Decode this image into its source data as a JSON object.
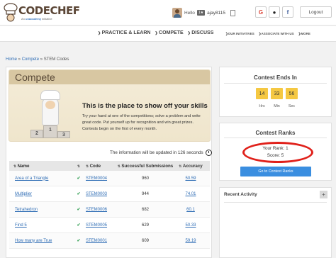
{
  "header": {
    "logo_text": "CODECHEF",
    "logo_sub_prefix": "An",
    "logo_sub_brand": "unacademy",
    "logo_sub_suffix": "initiative",
    "hello": "Hello",
    "rating_badge": "1★",
    "username": "ajay8115",
    "logout_label": "Logout",
    "social": [
      "G",
      "●",
      "f"
    ]
  },
  "nav": {
    "main": [
      "PRACTICE & LEARN",
      "COMPETE",
      "DISCUSS"
    ],
    "sub": [
      "OUR INITIATIVES",
      "ASSOCIATE WITH US",
      "MORE"
    ]
  },
  "breadcrumb": {
    "home": "Home",
    "sep1": " » ",
    "compete": "Compete",
    "sep2": " » ",
    "current": "STEM Codes"
  },
  "banner": {
    "title": "Compete",
    "heading": "This is the place to show off your skills",
    "text": "Try your hand at one of the competitions; solve a problem and write great code. Put yourself up for recognition and win great prizes. Contests begin on the first of every month.",
    "podium": [
      "2",
      "1",
      "3"
    ]
  },
  "info_text": "The information will be updated in 126 seconds",
  "table": {
    "headers": {
      "name": "Name",
      "code": "Code",
      "successful": "Successful Submissions",
      "accuracy": "Accuracy"
    },
    "rows": [
      {
        "name": "Area of a Triangle",
        "tick": "✔",
        "code": "STEM0004",
        "successful": "960",
        "accuracy": "50.59"
      },
      {
        "name": "Multiplier",
        "tick": "✔",
        "code": "STEM0003",
        "successful": "944",
        "accuracy": "74.01"
      },
      {
        "name": "Tetrahedron",
        "tick": "✔",
        "code": "STEM0006",
        "successful": "682",
        "accuracy": "60.1"
      },
      {
        "name": "Find 5",
        "tick": "✔",
        "code": "STEM0005",
        "successful": "629",
        "accuracy": "50.33"
      },
      {
        "name": "How many are True",
        "tick": "✔",
        "code": "STEM0001",
        "successful": "609",
        "accuracy": "59.19"
      }
    ]
  },
  "contest_ends": {
    "title": "Contest Ends In",
    "values": [
      "14",
      "33",
      "56"
    ],
    "labels": [
      "Hrs",
      "Min",
      "Sec"
    ]
  },
  "contest_ranks": {
    "title": "Contest Ranks",
    "rank": "Your Rank: 1",
    "score": "Score: 5",
    "button": "Go to Contest Ranks"
  },
  "recent": {
    "title": "Recent Activity",
    "plus": "+"
  },
  "colors": {
    "accent_blue": "#3a8ee0",
    "timer_yellow": "#f5c842",
    "highlight_red": "#e0211b",
    "tick_green": "#3aa35a"
  }
}
